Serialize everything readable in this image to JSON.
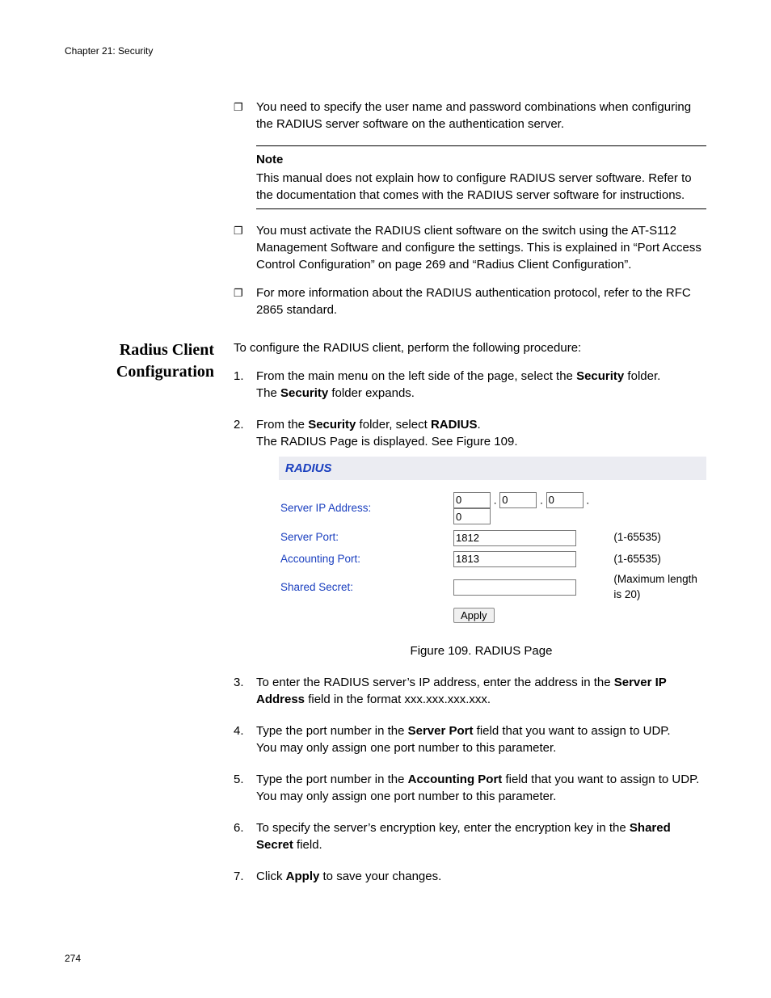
{
  "header": "Chapter 21: Security",
  "page_number": "274",
  "top_bullets": [
    "You need to specify the user name and password combinations when configuring the RADIUS server software on the authentication server."
  ],
  "note": {
    "title": "Note",
    "body": "This manual does not explain how to configure RADIUS server software. Refer to the documentation that comes with the RADIUS server software for instructions."
  },
  "after_note_bullets": [
    "You must activate the RADIUS client software on the switch using the AT-S112 Management Software and configure the settings. This is explained in “Port Access Control Configuration” on page 269 and “Radius Client Configuration”.",
    "For more information about the RADIUS authentication protocol, refer to the RFC 2865 standard."
  ],
  "section_title": "Radius Client Configuration",
  "intro": "To configure the RADIUS client, perform the following procedure:",
  "steps": {
    "s1a": "From the main menu on the left side of the page, select the ",
    "s1b": "Security",
    "s1c": " folder.",
    "s1d": "The ",
    "s1e": "Security",
    "s1f": " folder expands.",
    "s2a": "From the ",
    "s2b": "Security",
    "s2c": " folder, select ",
    "s2d": "RADIUS",
    "s2e": ".",
    "s2f": "The RADIUS Page is displayed. See Figure 109.",
    "s3a": "To enter the RADIUS server’s IP address, enter the address in the ",
    "s3b": "Server IP Address",
    "s3c": " field in the format xxx.xxx.xxx.xxx.",
    "s4a": "Type the port number in the ",
    "s4b": "Server Port",
    "s4c": " field that you want to assign to UDP.",
    "s4d": "You may only assign one port number to this parameter.",
    "s5a": "Type the port number in the ",
    "s5b": "Accounting Port",
    "s5c": " field that you want to assign to UDP.",
    "s5d": "You may only assign one port number to this parameter.",
    "s6a": "To specify the server’s encryption key, enter the encryption key in the ",
    "s6b": "Shared Secret",
    "s6c": " field.",
    "s7a": "Click ",
    "s7b": "Apply",
    "s7c": " to save your changes."
  },
  "figure": {
    "header": "RADIUS",
    "labels": {
      "ip": "Server IP Address:",
      "port": "Server Port:",
      "acct": "Accounting Port:",
      "secret": "Shared Secret:"
    },
    "values": {
      "ip": [
        "0",
        "0",
        "0",
        "0"
      ],
      "port": "1812",
      "acct": "1813",
      "secret": ""
    },
    "hints": {
      "port_range": "(1-65535)",
      "secret_max": "(Maximum length is 20)"
    },
    "apply": "Apply",
    "caption": "Figure 109. RADIUS Page",
    "dot": "."
  }
}
